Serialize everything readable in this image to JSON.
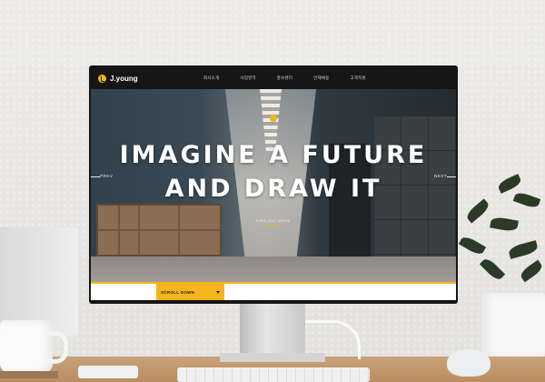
{
  "website": {
    "logo_text": "J.young",
    "nav_items": [
      "회사소개",
      "사업영역",
      "홍보센터",
      "인재채용",
      "고객지원"
    ],
    "hero_title_line1": "IMAGINE A FUTURE",
    "hero_title_line2": "AND DRAW IT",
    "prev_label": "PREV",
    "next_label": "NEXT",
    "find_more_label": "FIND OUT MORE",
    "scroll_down_label": "SCROLL DOWN"
  },
  "colors": {
    "accent": "#f6b51f",
    "nav_background": "#161616",
    "bezel": "#151515"
  },
  "icons": {
    "logo": "j-circle-logo-icon",
    "scroll": "chevron-down-icon"
  }
}
